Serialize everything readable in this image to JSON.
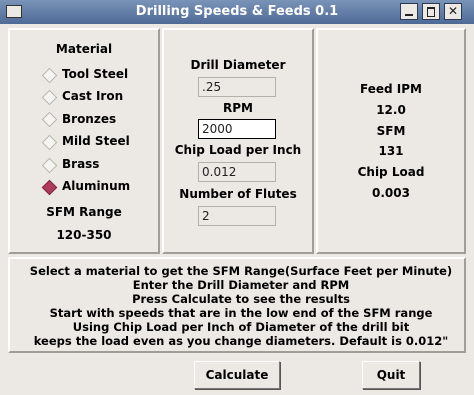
{
  "window": {
    "title": "Drilling Speeds & Feeds 0.1"
  },
  "material_panel": {
    "heading": "Material",
    "options": [
      {
        "label": "Tool Steel",
        "selected": false
      },
      {
        "label": "Cast Iron",
        "selected": false
      },
      {
        "label": "Bronzes",
        "selected": false
      },
      {
        "label": "Mild Steel",
        "selected": false
      },
      {
        "label": "Brass",
        "selected": false
      },
      {
        "label": "Aluminum",
        "selected": true
      }
    ],
    "sfm_range_label": "SFM Range",
    "sfm_range_value": "120-350"
  },
  "input_panel": {
    "diameter_label": "Drill Diameter",
    "diameter_value": ".25",
    "rpm_label": "RPM",
    "rpm_value": "2000",
    "chipload_label": "Chip Load per Inch",
    "chipload_value": "0.012",
    "flutes_label": "Number of Flutes",
    "flutes_value": "2"
  },
  "results_panel": {
    "feed_label": "Feed IPM",
    "feed_value": "12.0",
    "sfm_label": "SFM",
    "sfm_value": "131",
    "chipload_label": "Chip Load",
    "chipload_value": "0.003"
  },
  "help": {
    "lines": [
      "Select a material to get the SFM Range(Surface Feet per Minute)",
      "Enter the Drill Diameter and RPM",
      "Press Calculate to see the results",
      "Start with speeds that are in the low end of the SFM range",
      "Using Chip Load per Inch of Diameter of the drill bit",
      "keeps the load even as you change diameters. Default is 0.012\""
    ]
  },
  "buttons": {
    "calculate": "Calculate",
    "quit": "Quit"
  },
  "titlebar_buttons": {
    "minimize": "minimize-icon",
    "maximize": "maximize-icon",
    "close": "close-icon"
  },
  "colors": {
    "titlebar": "#5b7aa6",
    "radio_selected": "#b03a5b",
    "background": "#ece9e4"
  }
}
